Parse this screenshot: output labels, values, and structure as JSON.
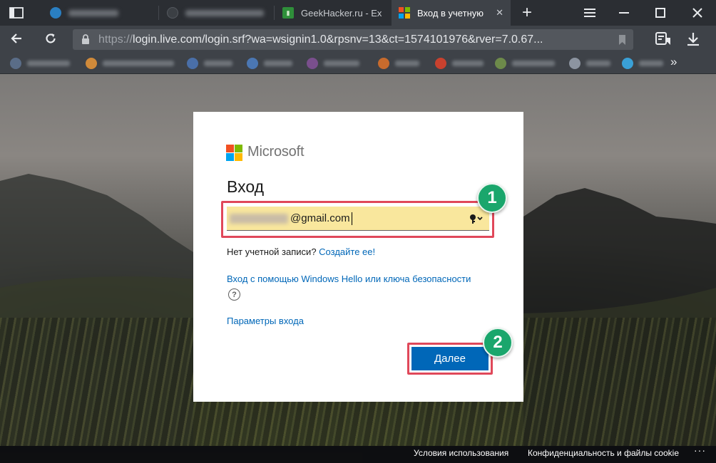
{
  "browser": {
    "tabs": [
      {
        "label": "GeekHacker.ru - Ex",
        "favicon_color": "#2f8f3a"
      },
      {
        "label": "Вход в учетную",
        "favicon_icon": "microsoft-logo-icon",
        "close": "✕"
      }
    ],
    "new_tab": "+",
    "url_scheme": "https://",
    "url_rest": "login.live.com/login.srf?wa=wsignin1.0&rpsnv=13&ct=1574101976&rver=7.0.67...",
    "bookmarks_more": "»",
    "colors": {
      "tabbar": "#2b2e33",
      "toolbar": "#3e4248",
      "url_box": "#53575d"
    }
  },
  "login": {
    "brand": "Microsoft",
    "title": "Вход",
    "email_value": "@gmail.com",
    "no_account_text": "Нет учетной записи?",
    "create_link": "Создайте ее!",
    "hello_link": "Вход с помощью Windows Hello или ключа безопасности",
    "help_icon": "?",
    "signin_options": "Параметры входа",
    "next_button": "Далее",
    "logo_colors": [
      "#f25022",
      "#7fba00",
      "#00a4ef",
      "#ffb900"
    ],
    "accent": "#0067b8"
  },
  "annotations": {
    "marker_1": "1",
    "marker_2": "2",
    "highlight_color": "#e0485a",
    "marker_color": "#1aa66c"
  },
  "footer": {
    "terms": "Условия использования",
    "privacy": "Конфиденциальность и файлы cookie",
    "more": "···"
  }
}
